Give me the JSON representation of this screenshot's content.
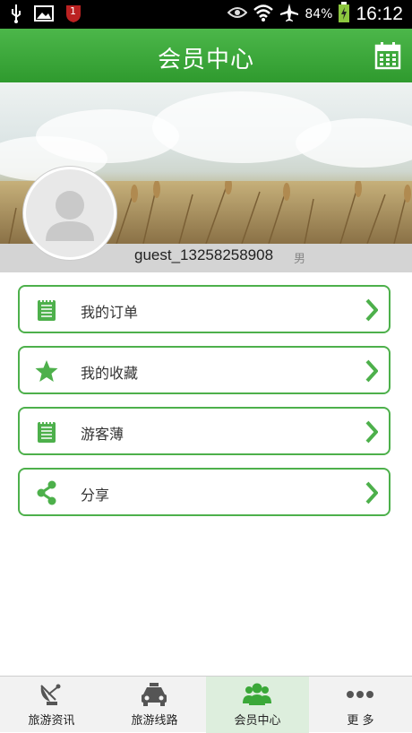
{
  "status_bar": {
    "battery": "84%",
    "time": "16:12",
    "notification_badge": "1"
  },
  "header": {
    "title": "会员中心",
    "calendar_icon": "calendar-icon"
  },
  "profile": {
    "username": "guest_13258258908",
    "gender": "男"
  },
  "menu": [
    {
      "label": "我的订单",
      "icon": "notepad-icon"
    },
    {
      "label": "我的收藏",
      "icon": "star-icon"
    },
    {
      "label": "游客薄",
      "icon": "notepad-icon"
    },
    {
      "label": "分享",
      "icon": "share-icon"
    }
  ],
  "bottom_nav": [
    {
      "label": "旅游资讯",
      "icon": "satellite-dish-icon"
    },
    {
      "label": "旅游线路",
      "icon": "car-icon"
    },
    {
      "label": "会员中心",
      "icon": "people-icon",
      "active": true
    },
    {
      "label": "更 多",
      "icon": "more-dots-icon"
    }
  ],
  "colors": {
    "brand_green": "#3aa838",
    "icon_green": "#4db04b"
  }
}
